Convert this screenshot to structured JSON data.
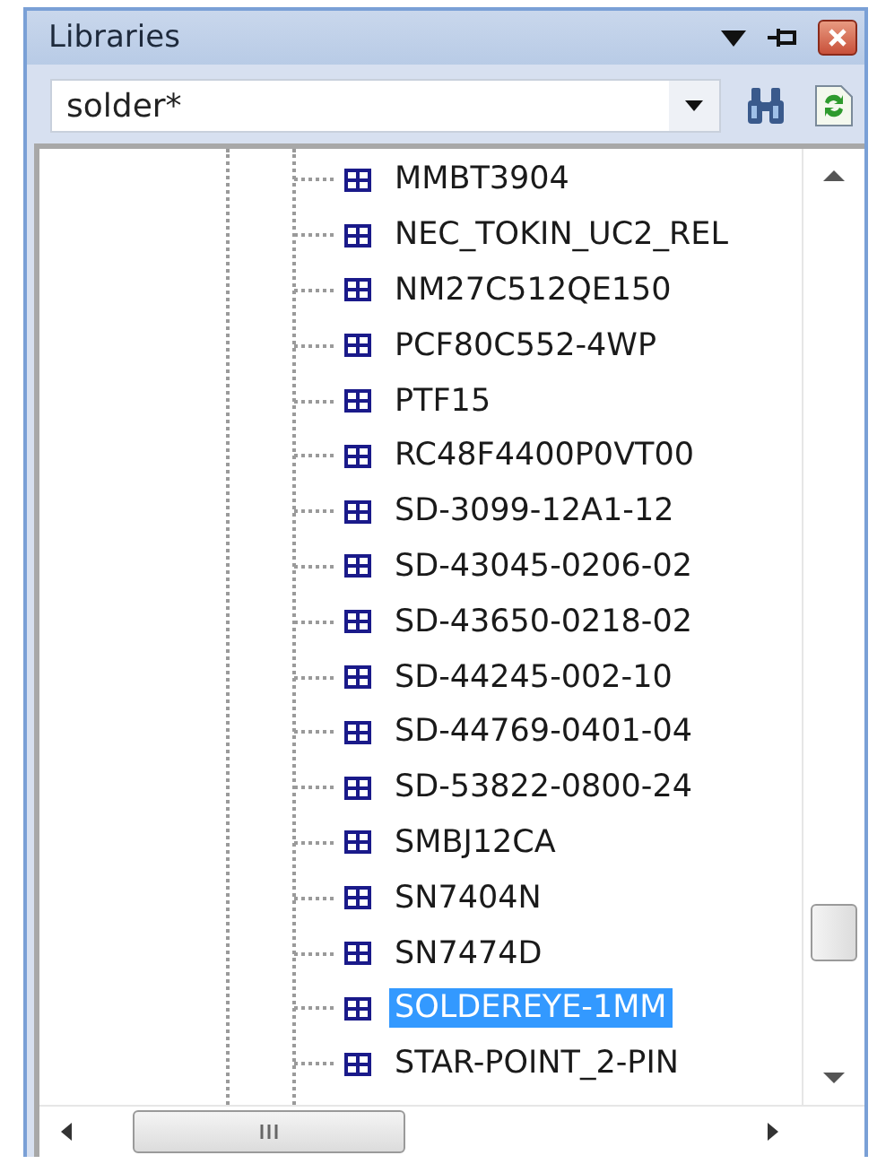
{
  "panel": {
    "title": "Libraries"
  },
  "search": {
    "value": "solder*"
  },
  "tree": {
    "items": [
      {
        "label": "MMBT3904",
        "selected": false
      },
      {
        "label": "NEC_TOKIN_UC2_REL",
        "selected": false
      },
      {
        "label": "NM27C512QE150",
        "selected": false
      },
      {
        "label": "PCF80C552-4WP",
        "selected": false
      },
      {
        "label": "PTF15",
        "selected": false
      },
      {
        "label": "RC48F4400P0VT00",
        "selected": false
      },
      {
        "label": "SD-3099-12A1-12",
        "selected": false
      },
      {
        "label": "SD-43045-0206-02",
        "selected": false
      },
      {
        "label": "SD-43650-0218-02",
        "selected": false
      },
      {
        "label": "SD-44245-002-10",
        "selected": false
      },
      {
        "label": "SD-44769-0401-04",
        "selected": false
      },
      {
        "label": "SD-53822-0800-24",
        "selected": false
      },
      {
        "label": "SMBJ12CA",
        "selected": false
      },
      {
        "label": "SN7404N",
        "selected": false
      },
      {
        "label": "SN7474D",
        "selected": false
      },
      {
        "label": "SOLDEREYE-1MM",
        "selected": true
      },
      {
        "label": "STAR-POINT_2-PIN",
        "selected": false
      }
    ]
  }
}
